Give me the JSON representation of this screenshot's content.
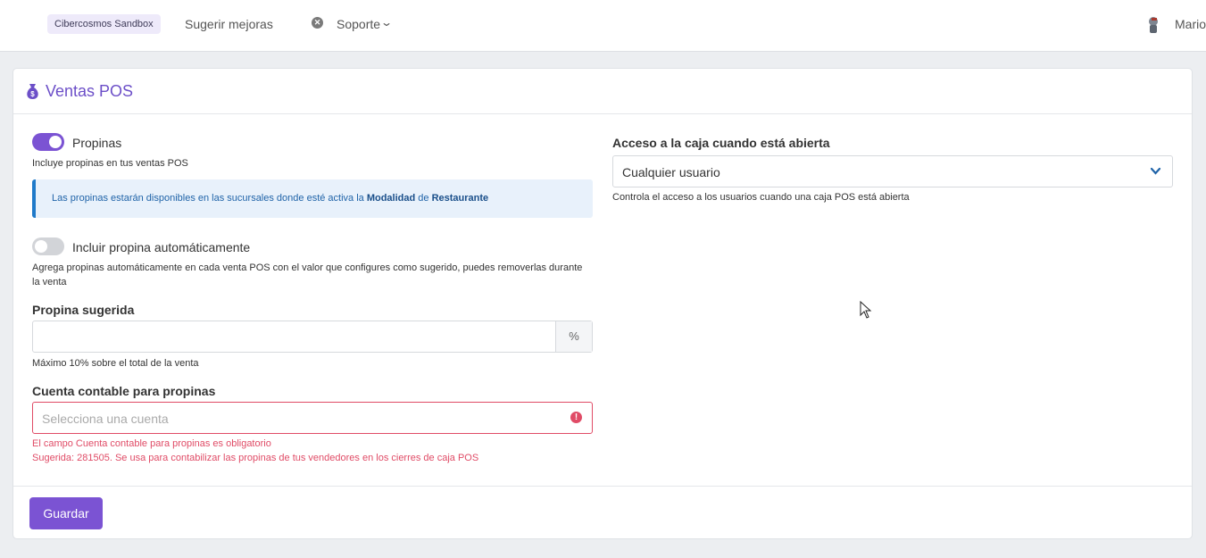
{
  "topbar": {
    "sandbox_label": "Cibercosmos Sandbox",
    "suggest_label": "Sugerir mejoras",
    "support_label": "Soporte",
    "user_name": "Mario"
  },
  "card": {
    "title": "Ventas POS",
    "save_label": "Guardar"
  },
  "tips": {
    "label": "Propinas",
    "enabled": true,
    "help": "Incluye propinas en tus ventas POS",
    "info_prefix": "Las propinas estarán disponibles en las sucursales donde esté activa la ",
    "info_bold1": "Modalidad",
    "info_mid": " de ",
    "info_bold2": "Restaurante"
  },
  "auto_tip": {
    "label": "Incluir propina automáticamente",
    "enabled": false,
    "help": "Agrega propinas automáticamente en cada venta POS con el valor que configures como sugerido, puedes removerlas durante la venta"
  },
  "suggested_tip": {
    "title": "Propina sugerida",
    "value": "",
    "addon": "%",
    "help": "Máximo 10% sobre el total de la venta"
  },
  "account": {
    "title": "Cuenta contable para propinas",
    "placeholder": "Selecciona una cuenta",
    "error_required": "El campo Cuenta contable para propinas es obligatorio",
    "error_suggested": "Sugerida: 281505. Se usa para contabilizar las propinas de tus vendedores en los cierres de caja POS"
  },
  "cash_access": {
    "title": "Acceso a la caja cuando está abierta",
    "value": "Cualquier usuario",
    "help": "Controla el acceso a los usuarios cuando una caja POS está abierta"
  },
  "colors": {
    "accent": "#7b53d3",
    "error": "#e04b66",
    "info": "#1f7ac9"
  }
}
